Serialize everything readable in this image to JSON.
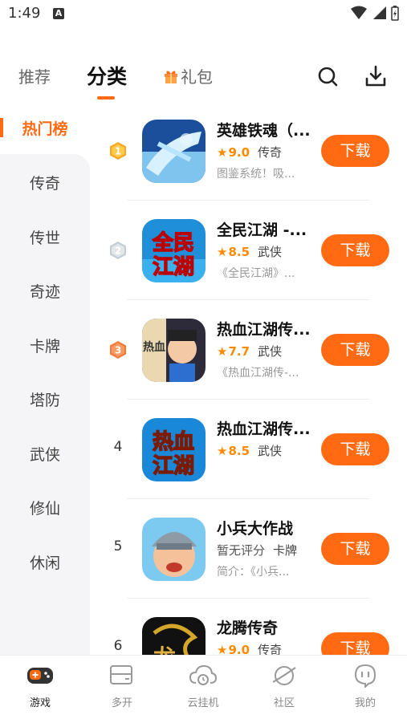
{
  "status": {
    "time": "1:49",
    "notif": "A"
  },
  "tabs": {
    "recommend": "推荐",
    "category": "分类",
    "gift": "礼包"
  },
  "sidebar": {
    "active": "热门榜",
    "items": [
      "传奇",
      "传世",
      "奇迹",
      "卡牌",
      "塔防",
      "武侠",
      "修仙",
      "休闲"
    ]
  },
  "games": [
    {
      "rank": "1",
      "name": "英雄铁魂（...",
      "rating": "9.0",
      "category": "传奇",
      "desc": "图鉴系统！吸...",
      "button": "下载"
    },
    {
      "rank": "2",
      "name": "全民江湖 -...",
      "rating": "8.5",
      "category": "武侠",
      "desc": "《全民江湖》...",
      "button": "下载"
    },
    {
      "rank": "3",
      "name": "热血江湖传...",
      "rating": "7.7",
      "category": "武侠",
      "desc": "《热血江湖传-...",
      "button": "下载"
    },
    {
      "rank": "4",
      "name": "热血江湖传...",
      "rating": "8.5",
      "category": "武侠",
      "desc": "",
      "button": "下载"
    },
    {
      "rank": "5",
      "name": "小兵大作战",
      "rating": "暂无评分",
      "category": "卡牌",
      "desc": "简介：《小兵...",
      "button": "下载"
    },
    {
      "rank": "6",
      "name": "龙腾传奇",
      "rating": "9.0",
      "category": "传奇",
      "desc": "",
      "button": "下载"
    }
  ],
  "nav": {
    "items": [
      "游戏",
      "多开",
      "云挂机",
      "社区",
      "我的"
    ]
  },
  "colors": {
    "accent": "#ff6a13",
    "gold": "#f5a623",
    "silver": "#c4ccd3",
    "bronze": "#f07a3a"
  }
}
